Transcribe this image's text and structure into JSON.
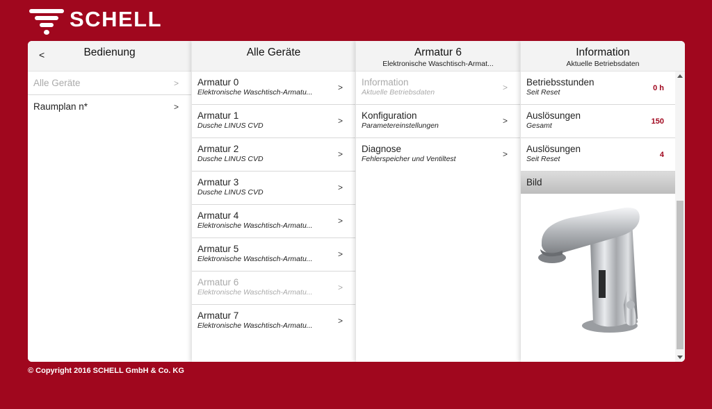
{
  "brand": {
    "name": "SCHELL"
  },
  "columns": {
    "bedienung": {
      "back_label": "<",
      "title": "Bedienung",
      "items": [
        {
          "label": "Alle Geräte",
          "chevron": ">"
        },
        {
          "label": "Raumplan n*",
          "chevron": ">"
        }
      ]
    },
    "geraete": {
      "title": "Alle Geräte",
      "items": [
        {
          "label": "Armatur 0",
          "sub": "Elektronische Waschtisch-Armatu...",
          "chevron": ">"
        },
        {
          "label": "Armatur 1",
          "sub": "Dusche LINUS CVD",
          "chevron": ">"
        },
        {
          "label": "Armatur 2",
          "sub": "Dusche LINUS CVD",
          "chevron": ">"
        },
        {
          "label": "Armatur 3",
          "sub": "Dusche LINUS CVD",
          "chevron": ">"
        },
        {
          "label": "Armatur 4",
          "sub": "Elektronische Waschtisch-Armatu...",
          "chevron": ">"
        },
        {
          "label": "Armatur 5",
          "sub": "Elektronische Waschtisch-Armatu...",
          "chevron": ">"
        },
        {
          "label": "Armatur 6",
          "sub": "Elektronische Waschtisch-Armatu...",
          "chevron": ">"
        },
        {
          "label": "Armatur 7",
          "sub": "Elektronische Waschtisch-Armatu...",
          "chevron": ">"
        }
      ]
    },
    "armatur": {
      "title": "Armatur 6",
      "subtitle": "Elektronische Waschtisch-Armat...",
      "items": [
        {
          "label": "Information",
          "sub": "Aktuelle Betriebsdaten",
          "chevron": ">"
        },
        {
          "label": "Konfiguration",
          "sub": "Parametereinstellungen",
          "chevron": ">"
        },
        {
          "label": "Diagnose",
          "sub": "Fehlerspeicher und Ventiltest",
          "chevron": ">"
        }
      ]
    },
    "information": {
      "title": "Information",
      "subtitle": "Aktuelle Betriebsdaten",
      "rows": [
        {
          "label": "Betriebsstunden",
          "sub": "Seit Reset",
          "value": "0 h"
        },
        {
          "label": "Auslösungen",
          "sub": "Gesamt",
          "value": "150"
        },
        {
          "label": "Auslösungen",
          "sub": "Seit Reset",
          "value": "4"
        }
      ],
      "image_section": "Bild"
    }
  },
  "footer": {
    "copyright": "© Copyright 2016 SCHELL GmbH & Co. KG"
  },
  "colors": {
    "brand_red": "#a0071e",
    "value_red": "#a0071e"
  },
  "icons": {
    "logo": "schell-water-logo-icon",
    "scroll_up": "arrow-up-icon",
    "scroll_down": "arrow-down-icon"
  }
}
